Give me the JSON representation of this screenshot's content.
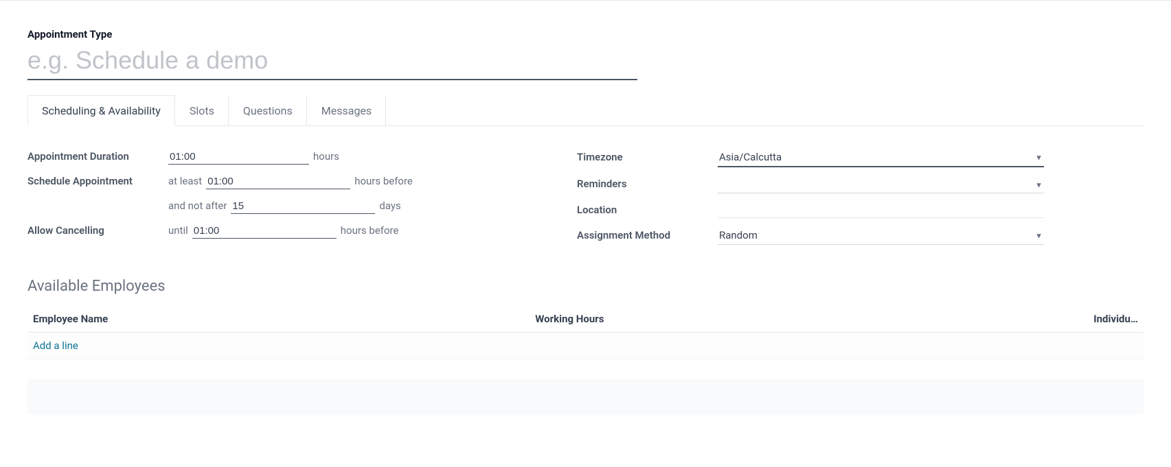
{
  "header": {
    "title_label": "Appointment Type",
    "title_placeholder": "e.g. Schedule a demo",
    "title_value": ""
  },
  "tabs": [
    {
      "label": "Scheduling & Availability",
      "active": true
    },
    {
      "label": "Slots",
      "active": false
    },
    {
      "label": "Questions",
      "active": false
    },
    {
      "label": "Messages",
      "active": false
    }
  ],
  "left": {
    "duration_label": "Appointment Duration",
    "duration_value": "01:00",
    "duration_suffix": "hours",
    "schedule_label": "Schedule Appointment",
    "schedule_prefix1": "at least",
    "schedule_value1": "01:00",
    "schedule_suffix1": "hours before",
    "schedule_prefix2": "and not after",
    "schedule_value2": "15",
    "schedule_suffix2": "days",
    "cancel_label": "Allow Cancelling",
    "cancel_prefix": "until",
    "cancel_value": "01:00",
    "cancel_suffix": "hours before"
  },
  "right": {
    "timezone_label": "Timezone",
    "timezone_value": "Asia/Calcutta",
    "reminders_label": "Reminders",
    "reminders_value": "",
    "location_label": "Location",
    "location_value": "",
    "assignment_label": "Assignment Method",
    "assignment_value": "Random"
  },
  "employees": {
    "section_title": "Available Employees",
    "col_name": "Employee Name",
    "col_hours": "Working Hours",
    "col_individu": "Individu…",
    "add_line": "Add a line"
  }
}
